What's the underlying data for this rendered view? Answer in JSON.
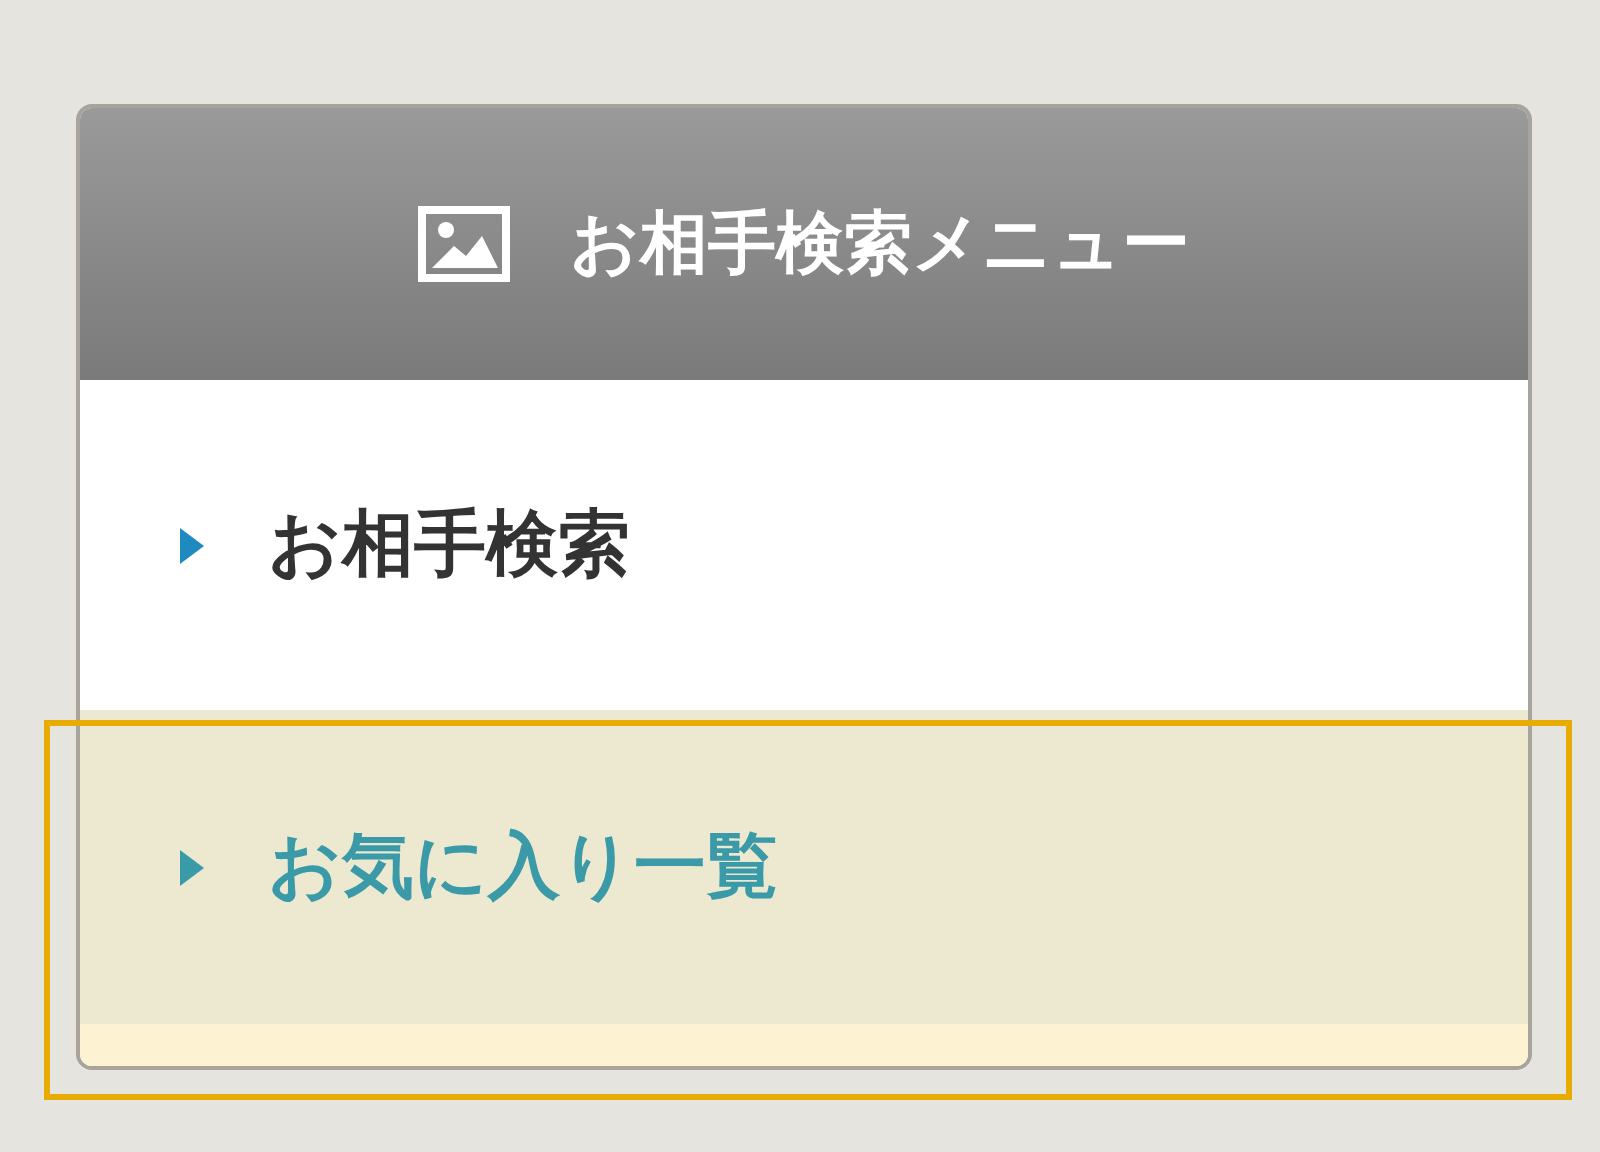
{
  "menu": {
    "title": "お相手検索メニュー",
    "items": [
      {
        "label": "お相手検索",
        "selected": false
      },
      {
        "label": "お気に入り一覧",
        "selected": true
      }
    ]
  }
}
